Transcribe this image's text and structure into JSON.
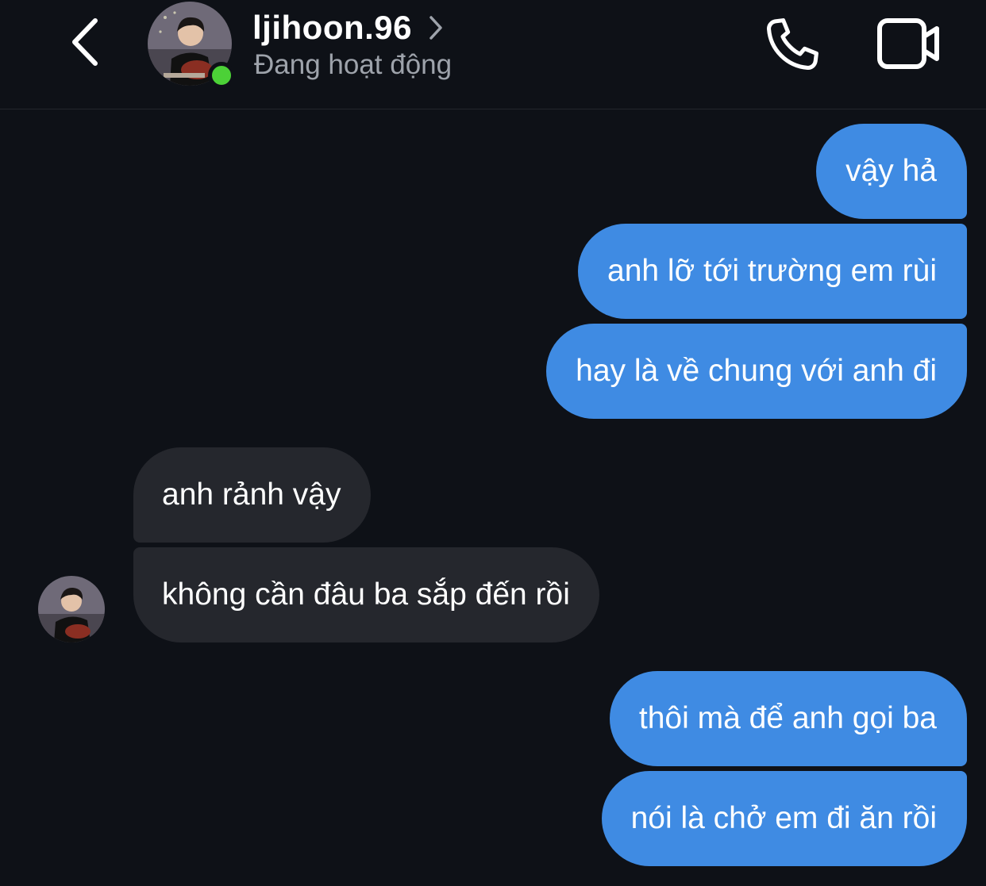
{
  "header": {
    "username": "ljihoon.96",
    "status": "Đang hoạt động",
    "back_icon": "chevron-left-icon",
    "profile_chevron_icon": "chevron-right-icon",
    "call_icon": "phone-icon",
    "video_icon": "video-camera-icon",
    "online_color": "#4cd137"
  },
  "messages": [
    {
      "side": "sent",
      "text": "vậy hả"
    },
    {
      "side": "sent",
      "text": "anh lỡ tới trường em rùi"
    },
    {
      "side": "sent",
      "text": "hay là về chung với anh đi"
    },
    {
      "side": "received",
      "text": "anh rảnh vậy"
    },
    {
      "side": "received",
      "text": "không cần đâu ba sắp đến rồi"
    },
    {
      "side": "sent",
      "text": "thôi mà để anh gọi ba"
    },
    {
      "side": "sent",
      "text": "nói là chở em đi ăn rồi"
    }
  ],
  "colors": {
    "background": "#0e1117",
    "sent_bubble": "#3f8be3",
    "received_bubble": "#25272d",
    "status_text": "#9ea3ab"
  }
}
